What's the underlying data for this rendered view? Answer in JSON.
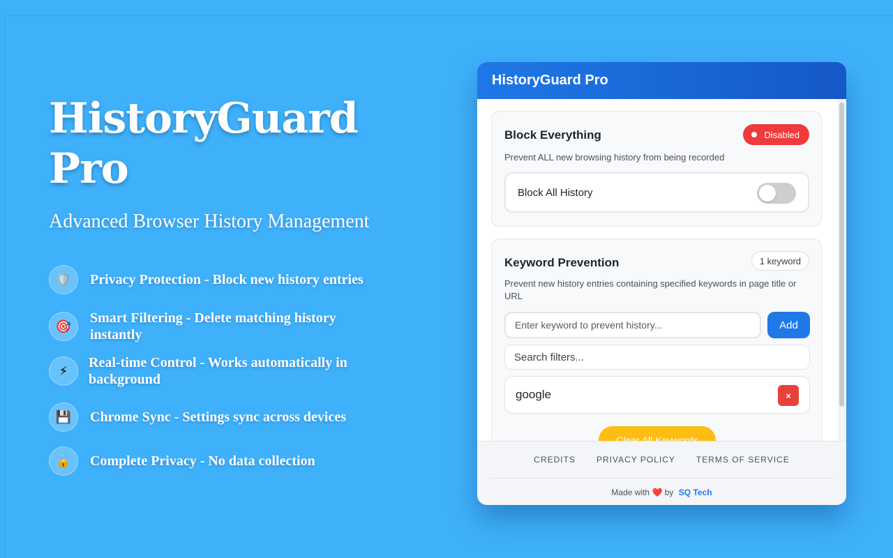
{
  "hero": {
    "title_line1": "HistoryGuard",
    "title_line2": "Pro",
    "subtitle": "Advanced Browser History Management"
  },
  "features": [
    {
      "icon": "shield-icon",
      "glyph": "🛡️",
      "text": "Privacy Protection - Block new history entries"
    },
    {
      "icon": "target-icon",
      "glyph": "🎯",
      "text": "Smart Filtering - Delete matching history instantly"
    },
    {
      "icon": "lightning-icon",
      "glyph": "⚡",
      "text": "Real-time Control - Works automatically in background"
    },
    {
      "icon": "floppy-disk-icon",
      "glyph": "💾",
      "text": "Chrome Sync - Settings sync across devices"
    },
    {
      "icon": "lock-icon",
      "glyph": "🔒",
      "text": "Complete Privacy - No data collection"
    }
  ],
  "popup": {
    "title": "HistoryGuard Pro",
    "block_card": {
      "title": "Block Everything",
      "status": "Disabled",
      "description": "Prevent ALL new browsing history from being recorded",
      "toggle_label": "Block All History",
      "toggle_on": false
    },
    "keyword_card": {
      "title": "Keyword Prevention",
      "count": "1 keyword",
      "description": "Prevent new history entries containing specified keywords in page title or URL",
      "input_placeholder": "Enter keyword to prevent history...",
      "add_label": "Add",
      "search_placeholder": "Search filters...",
      "keywords": [
        "google"
      ],
      "remove_label": "×",
      "clear_label": "Clear All Keywords"
    },
    "footer": {
      "links": [
        "CREDITS",
        "PRIVACY POLICY",
        "TERMS OF SERVICE"
      ],
      "made_with": "Made with",
      "heart": "❤️",
      "by": "by",
      "brand": "SQ Tech"
    }
  },
  "colors": {
    "background": "#3fb1fb",
    "header": "#1f78e6",
    "danger": "#ef3b3b",
    "warning": "#fdbd13"
  }
}
